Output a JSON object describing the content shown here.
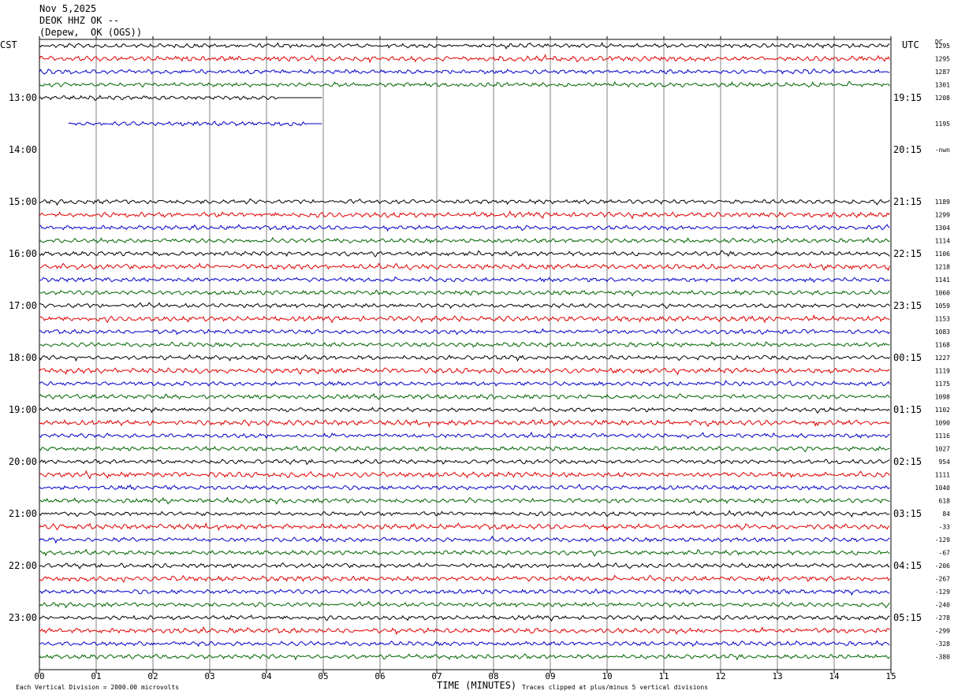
{
  "header": {
    "date": "Nov 5,2025",
    "station": "DEOK HHZ OK --",
    "location": "(Depew,  OK (OGS))"
  },
  "corner": {
    "left_tz": "CST",
    "right_tz": "UTC",
    "dc_label": "DC"
  },
  "footer": {
    "xlabel": "TIME (MINUTES)",
    "scale_note": "Each Vertical Division = 2000.00 microvolts",
    "clip_note": "Traces clipped at plus/minus 5 vertical divisions"
  },
  "colors": {
    "cycle": [
      "#000000",
      "#e00000",
      "#0000c8",
      "#006400"
    ],
    "grid": "#808080"
  },
  "chart_data": {
    "type": "line",
    "title": "DEOK HHZ OK --",
    "xlabel": "TIME (MINUTES)",
    "xlim": [
      0,
      15
    ],
    "x_ticks": [
      "00",
      "01",
      "02",
      "03",
      "04",
      "05",
      "06",
      "07",
      "08",
      "09",
      "10",
      "11",
      "12",
      "13",
      "14",
      "15"
    ],
    "rows_per_hour": 4,
    "left_hour_labels": [
      "13:00",
      "14:00",
      "15:00",
      "16:00",
      "17:00",
      "18:00",
      "19:00",
      "20:00",
      "21:00",
      "22:00",
      "23:00"
    ],
    "right_hour_labels": [
      "19:15",
      "20:15",
      "21:15",
      "22:15",
      "23:15",
      "00:15",
      "01:15",
      "02:15",
      "03:15",
      "04:15",
      "05:15"
    ],
    "dc_offsets": [
      "1295",
      "1295",
      "1287",
      "1301",
      "1208",
      "",
      "1195",
      "",
      "-nwn",
      "",
      "",
      "",
      "1189",
      "1299",
      "1304",
      "1114",
      "1106",
      "1218",
      "1141",
      "1060",
      "1059",
      "1153",
      "1083",
      "1168",
      "1227",
      "1119",
      "1175",
      "1098",
      "1102",
      "1090",
      "1116",
      "1027",
      "954",
      "1111",
      "1040",
      "618",
      "84",
      "-33",
      "-129",
      "-67",
      "-206",
      "-267",
      "-129",
      "-240",
      "-278",
      "-299",
      "-328",
      "-380"
    ],
    "gaps": [
      {
        "row": 4,
        "from_min": 5,
        "to_min": 15
      },
      {
        "row": 5,
        "from_min": 0,
        "to_min": 15
      },
      {
        "row": 6,
        "from_min": 0,
        "to_min": 0.5
      },
      {
        "row": 6,
        "from_min": 5,
        "to_min": 15
      },
      {
        "row": 7,
        "from_min": 0,
        "to_min": 15
      },
      {
        "row": 8,
        "from_min": 0,
        "to_min": 15
      },
      {
        "row": 9,
        "from_min": 0,
        "to_min": 15
      },
      {
        "row": 10,
        "from_min": 0,
        "to_min": 15
      },
      {
        "row": 11,
        "from_min": 0,
        "to_min": 15
      }
    ],
    "flat_segments": [
      {
        "row": 4,
        "from_min": 4.2,
        "to_min": 5
      },
      {
        "row": 6,
        "from_min": 4.7,
        "to_min": 5
      }
    ],
    "grid": true
  }
}
